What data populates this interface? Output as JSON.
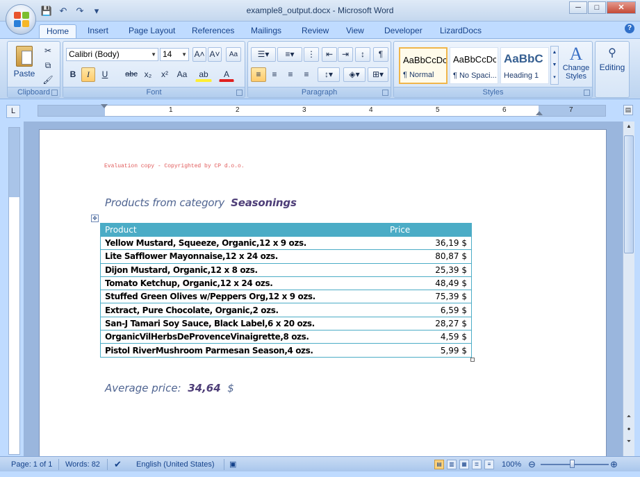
{
  "window": {
    "title": "example8_output.docx - Microsoft Word",
    "minimize": "─",
    "maximize": "□",
    "close": "✕"
  },
  "qat": {
    "save_icon": "💾",
    "undo_icon": "↶",
    "redo_icon": "↷",
    "customize_icon": "▾"
  },
  "tabs": [
    {
      "label": "Home"
    },
    {
      "label": "Insert"
    },
    {
      "label": "Page Layout"
    },
    {
      "label": "References"
    },
    {
      "label": "Mailings"
    },
    {
      "label": "Review"
    },
    {
      "label": "View"
    },
    {
      "label": "Developer"
    },
    {
      "label": "LizardDocs"
    }
  ],
  "help": "?",
  "ribbon": {
    "clipboard": {
      "label": "Clipboard",
      "paste": "Paste"
    },
    "font": {
      "label": "Font",
      "font_name": "Calibri (Body)",
      "font_size": "14",
      "grow": "A˄",
      "shrink": "A˅",
      "clear": "Aa",
      "bold": "B",
      "italic": "I",
      "underline": "U",
      "strike": "abc",
      "subscript": "x₂",
      "superscript": "x²",
      "change_case": "Aa",
      "highlight": "ab",
      "font_color": "A"
    },
    "paragraph": {
      "label": "Paragraph",
      "pilcrow": "¶"
    },
    "styles": {
      "label": "Styles",
      "items": [
        {
          "preview": "AaBbCcDc",
          "name": "¶ Normal"
        },
        {
          "preview": "AaBbCcDc",
          "name": "¶ No Spaci..."
        },
        {
          "preview": "AaBbC",
          "name": "Heading 1"
        }
      ],
      "change_styles": "Change Styles"
    },
    "editing": {
      "label": "Editing"
    }
  },
  "ruler": {
    "corner": "L",
    "numbers": [
      "1",
      "2",
      "3",
      "4",
      "5",
      "6",
      "7"
    ]
  },
  "document": {
    "evaluation": "Evaluation copy - Copyrighted by CP d.o.o.",
    "heading_prefix": "Products from  category",
    "heading_category": "Seasonings",
    "table": {
      "headers": [
        "Product",
        "Price"
      ],
      "rows": [
        {
          "product": "Yellow Mustard, Squeeze, Organic,12 x 9 ozs.",
          "price": "36,19 $"
        },
        {
          "product": "Lite Safflower Mayonnaise,12 x 24 ozs.",
          "price": "80,87 $"
        },
        {
          "product": "Dijon Mustard, Organic,12 x 8 ozs.",
          "price": "25,39 $"
        },
        {
          "product": "Tomato Ketchup, Organic,12 x 24 ozs.",
          "price": "48,49 $"
        },
        {
          "product": "Stuffed Green Olives w/Peppers Org,12 x 9 ozs.",
          "price": "75,39 $"
        },
        {
          "product": "Extract, Pure Chocolate, Organic,2 ozs.",
          "price": "6,59 $"
        },
        {
          "product": "San-J Tamari Soy Sauce, Black Label,6 x 20 ozs.",
          "price": "28,27 $"
        },
        {
          "product": "OrganicVilHerbsDeProvenceVinaigrette,8 ozs.",
          "price": "4,59 $"
        },
        {
          "product": "Pistol RiverMushroom Parmesan Season,4 ozs.",
          "price": "5,99 $"
        }
      ]
    },
    "average_label": "Average price:",
    "average_value": "34,64",
    "average_currency": "$"
  },
  "status": {
    "page": "Page: 1 of 1",
    "words": "Words: 82",
    "language": "English (United States)",
    "zoom": "100%"
  }
}
